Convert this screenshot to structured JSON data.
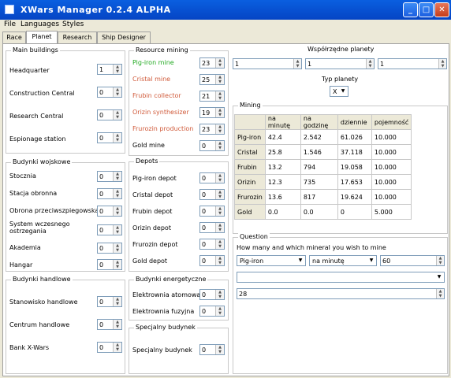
{
  "window": {
    "title": "XWars Manager  0.2.4 ALPHA",
    "min": "_",
    "max": "□",
    "close": "✕"
  },
  "menu": [
    "File",
    "Languages",
    "Styles"
  ],
  "tabs": [
    "Race",
    "Planet",
    "Research",
    "Ship Designer"
  ],
  "main_buildings": {
    "title": "Main buildings",
    "items": [
      {
        "label": "Headquarter",
        "value": "1"
      },
      {
        "label": "Construction Central",
        "value": "0"
      },
      {
        "label": "Research Central",
        "value": "0"
      },
      {
        "label": "Espionage station",
        "value": "0"
      }
    ]
  },
  "military": {
    "title": "Budynki wojskowe",
    "items": [
      {
        "label": "Stocznia",
        "value": "0"
      },
      {
        "label": "Stacja obronna",
        "value": "0"
      },
      {
        "label": "Obrona przeciwszpiegowska",
        "value": "0"
      },
      {
        "label": "System wczesnego ostrzegania",
        "value": "0"
      },
      {
        "label": "Akademia",
        "value": "0"
      },
      {
        "label": "Hangar",
        "value": "0"
      }
    ]
  },
  "trade": {
    "title": "Budynki handlowe",
    "items": [
      {
        "label": "Stanowisko handlowe",
        "value": "0"
      },
      {
        "label": "Centrum handlowe",
        "value": "0"
      },
      {
        "label": "Bank X-Wars",
        "value": "0"
      }
    ]
  },
  "resource_mining": {
    "title": "Resource mining",
    "items": [
      {
        "label": "Pig-iron mine",
        "value": "23",
        "color": "#22aa22"
      },
      {
        "label": "Cristal mine",
        "value": "25",
        "color": "#d05a3a"
      },
      {
        "label": "Frubin collector",
        "value": "21",
        "color": "#d05a3a"
      },
      {
        "label": "Orizin synthesizer",
        "value": "19",
        "color": "#d05a3a"
      },
      {
        "label": "Frurozin production",
        "value": "23",
        "color": "#d05a3a"
      },
      {
        "label": "Gold mine",
        "value": "0",
        "color": "#000000"
      }
    ]
  },
  "depots": {
    "title": "Depots",
    "items": [
      {
        "label": "Pig-iron depot",
        "value": "0"
      },
      {
        "label": "Cristal depot",
        "value": "0"
      },
      {
        "label": "Frubin depot",
        "value": "0"
      },
      {
        "label": "Orizin depot",
        "value": "0"
      },
      {
        "label": "Frurozin depot",
        "value": "0"
      },
      {
        "label": "Gold depot",
        "value": "0"
      }
    ]
  },
  "energy": {
    "title": "Budynki energetyczne",
    "items": [
      {
        "label": "Elektrownia atomowa",
        "value": "0"
      },
      {
        "label": "Elektrownia fuzyjna",
        "value": "0"
      }
    ]
  },
  "special": {
    "title": "Specjalny budynek",
    "items": [
      {
        "label": "Specjalny budynek",
        "value": "0"
      }
    ]
  },
  "coords": {
    "title": "Współrzędne planety",
    "values": [
      "1",
      "1",
      "1"
    ]
  },
  "planet_type": {
    "label": "Typ planety",
    "value": "X"
  },
  "mining": {
    "title": "Mining",
    "headers": [
      "na minutę",
      "na godzinę",
      "dziennie",
      "pojemność"
    ],
    "rows": [
      {
        "name": "Pig-iron",
        "cells": [
          "42.4",
          "2.542",
          "61.026",
          "10.000"
        ]
      },
      {
        "name": "Cristal",
        "cells": [
          "25.8",
          "1.546",
          "37.118",
          "10.000"
        ]
      },
      {
        "name": "Frubin",
        "cells": [
          "13.2",
          "794",
          "19.058",
          "10.000"
        ]
      },
      {
        "name": "Orizin",
        "cells": [
          "12.3",
          "735",
          "17.653",
          "10.000"
        ]
      },
      {
        "name": "Frurozin",
        "cells": [
          "13.6",
          "817",
          "19.624",
          "10.000"
        ]
      },
      {
        "name": "Gold",
        "cells": [
          "0.0",
          "0.0",
          "0",
          "5.000"
        ]
      }
    ]
  },
  "question": {
    "title": "Question",
    "prompt": "How many and which mineral you wish to mine",
    "mineral": "Pig-iron",
    "period": "na minutę",
    "amount": "60",
    "empty": "",
    "result": "28"
  }
}
